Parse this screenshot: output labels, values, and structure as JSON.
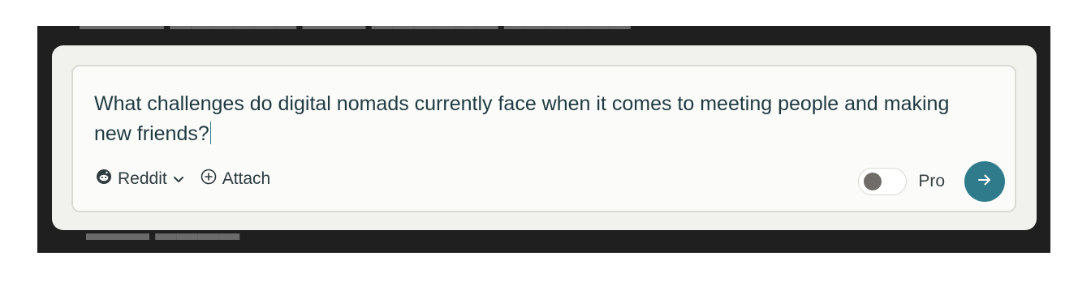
{
  "composer": {
    "query_text": "What challenges do digital nomads currently face when it comes to meeting people and making new friends?"
  },
  "toolbar": {
    "source_label": "Reddit",
    "source_icon": "reddit-icon",
    "source_dropdown_icon": "chevron-down-icon",
    "attach_label": "Attach",
    "attach_icon": "plus-circle-icon",
    "pro_label": "Pro",
    "pro_enabled": false,
    "send_icon": "arrow-right-icon"
  },
  "colors": {
    "accent": "#2f7b8c",
    "text": "#1f3a40",
    "panel": "#f1f2ee",
    "backdrop": "#1f1f1f"
  }
}
